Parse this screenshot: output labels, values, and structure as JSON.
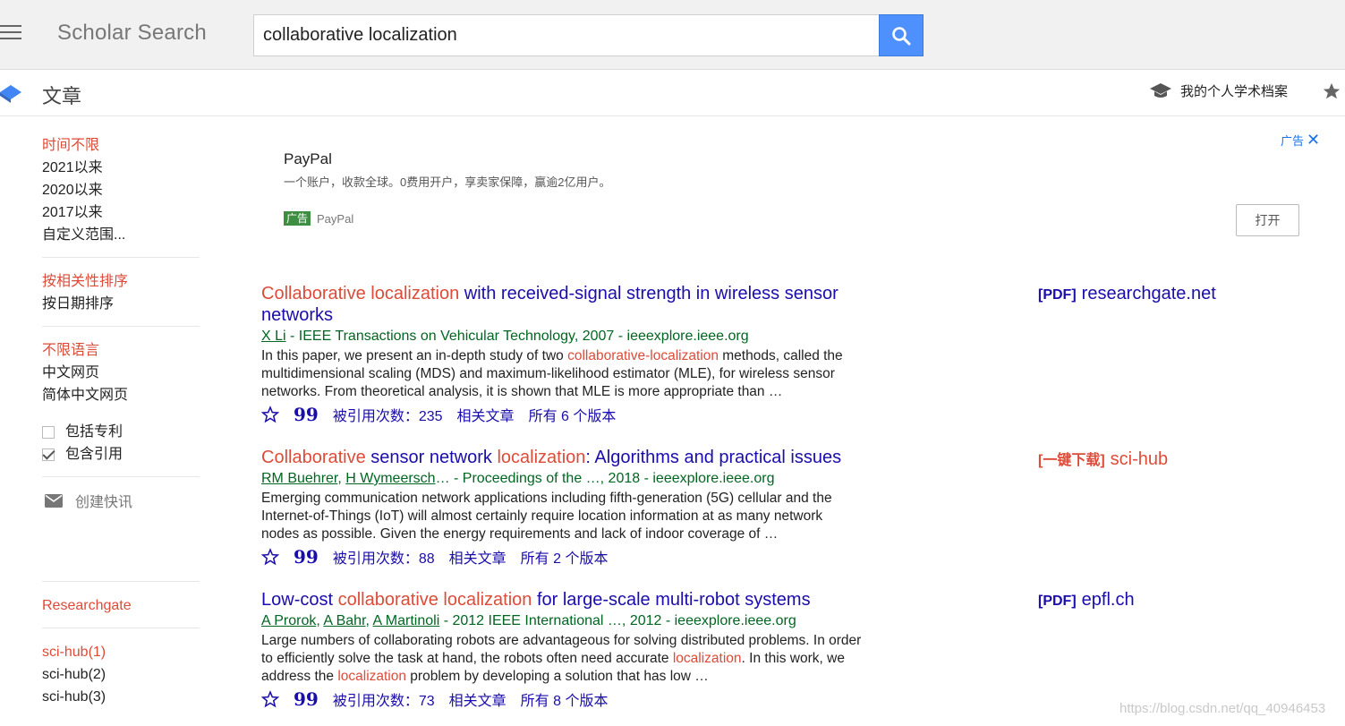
{
  "header": {
    "brand": "Scholar Search",
    "search_value": "collaborative localization"
  },
  "subheader": {
    "title": "文章",
    "profile_label": "我的个人学术档案"
  },
  "sidebar": {
    "time_filters": [
      "时间不限",
      "2021以来",
      "2020以来",
      "2017以来",
      "自定义范围..."
    ],
    "sort_options": [
      "按相关性排序",
      "按日期排序"
    ],
    "language_options": [
      "不限语言",
      "中文网页",
      "简体中文网页"
    ],
    "include_patents": "包括专利",
    "include_citations": "包含引用",
    "create_alert": "创建快讯",
    "researchgate": "Researchgate",
    "scihub_links": [
      "sci-hub(1)",
      "sci-hub(2)",
      "sci-hub(3)"
    ]
  },
  "ad": {
    "ad_label": "广告",
    "title": "PayPal",
    "description": "一个账户，收款全球。0费用开户，享卖家保障，赢逾2亿用户。",
    "tag": "广告",
    "source": "PayPal",
    "open_label": "打开"
  },
  "results": [
    {
      "title_hl1": "Collaborative localization",
      "title_rest1": " with received-signal strength in wireless sensor networks",
      "authors": [
        "X Li"
      ],
      "venue": " - IEEE Transactions on Vehicular Technology, 2007 - ieeexplore.ieee.org",
      "snippet_a": "In this paper, we present an in-depth study of two ",
      "snippet_hl": "collaborative-localization",
      "snippet_b": " methods, called the multidimensional scaling (MDS) and maximum-likelihood estimator (MLE), for wireless sensor networks. From theoretical analysis, it is shown that MLE is more appropriate than …",
      "cited": "被引用次数：235",
      "related": "相关文章",
      "versions": "所有 6 个版本",
      "side_tag": "[PDF]",
      "side_site": "researchgate.net"
    },
    {
      "title_hl1": "Collaborative",
      "title_mid": " sensor network ",
      "title_hl2": "localization",
      "title_rest1": ": Algorithms and practical issues",
      "authors": [
        "RM Buehrer",
        "H Wymeersch"
      ],
      "venue": "… - Proceedings of the …, 2018 - ieeexplore.ieee.org",
      "snippet": "Emerging communication network applications including fifth-generation (5G) cellular and the Internet-of-Things (IoT) will almost certainly require location information at as many network nodes as possible. Given the energy requirements and lack of indoor coverage of …",
      "cited": "被引用次数：88",
      "related": "相关文章",
      "versions": "所有 2 个版本",
      "side_tag": "[一键下载]",
      "side_site": "sci-hub"
    },
    {
      "title_pre": "Low-cost ",
      "title_hl1": "collaborative localization",
      "title_rest1": " for large-scale multi-robot systems",
      "authors": [
        "A Prorok",
        "A Bahr",
        "A Martinoli"
      ],
      "venue": " - 2012 IEEE International …, 2012 - ieeexplore.ieee.org",
      "snippet_a": "Large numbers of collaborating robots are advantageous for solving distributed problems. In order to efficiently solve the task at hand, the robots often need accurate ",
      "snippet_hl": "localization",
      "snippet_b": ". In this work, we address the ",
      "snippet_hl2": "localization",
      "snippet_c": " problem by developing a solution that has low …",
      "cited": "被引用次数：73",
      "related": "相关文章",
      "versions": "所有 8 个版本",
      "side_tag": "[PDF]",
      "side_site": "epfl.ch"
    }
  ],
  "watermark": "https://blog.csdn.net/qq_40946453",
  "colors": {
    "accent_red": "#dd4b39",
    "link_blue": "#1a0dab",
    "green": "#006621",
    "search_blue": "#4d90fe"
  }
}
